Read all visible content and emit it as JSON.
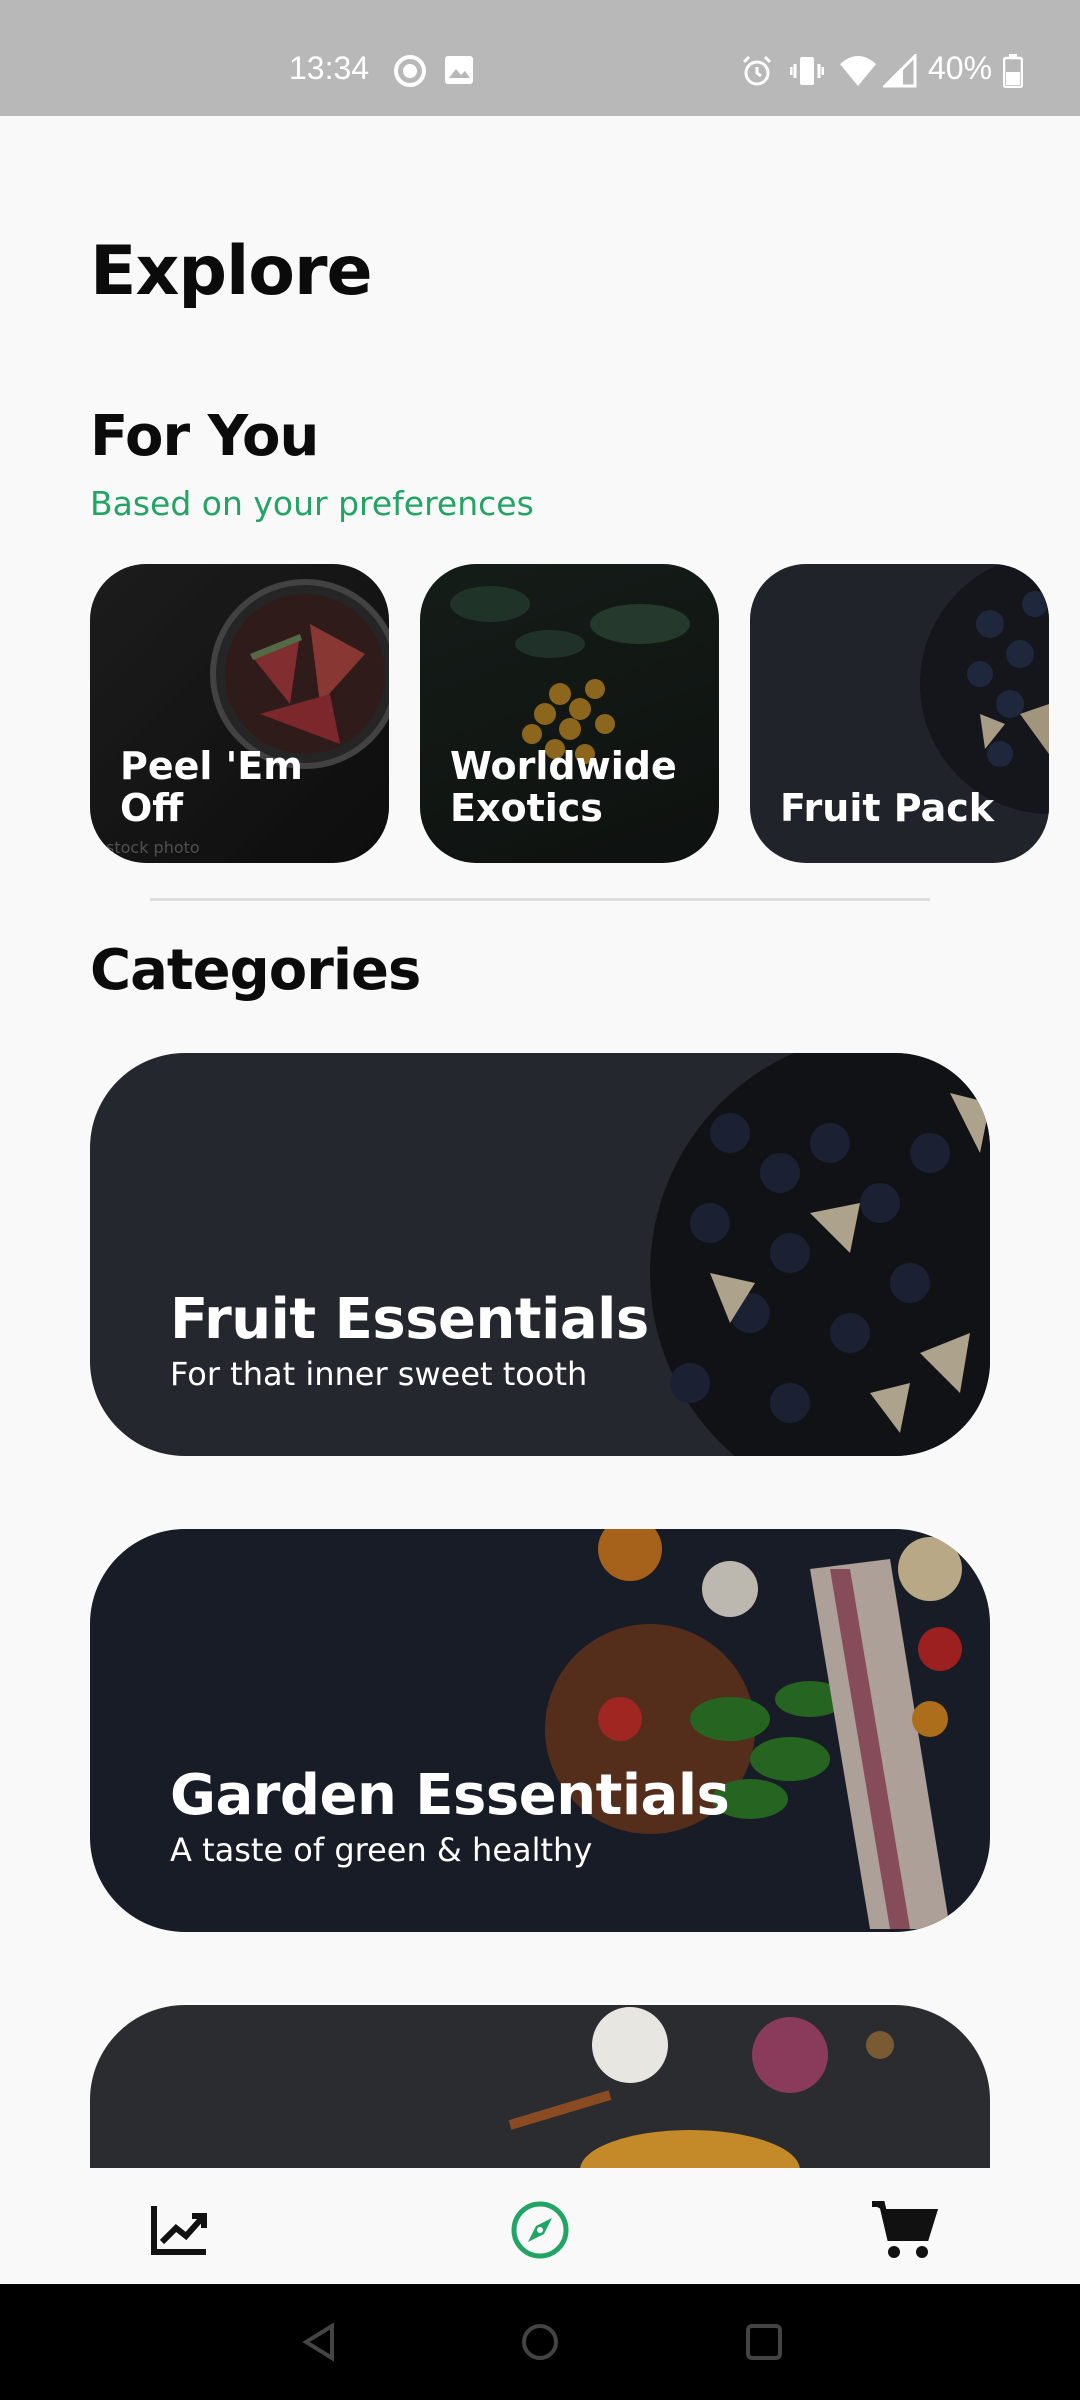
{
  "status_bar": {
    "time": "13:34",
    "battery": "40%",
    "icons": [
      "record-icon",
      "image-icon",
      "alarm-icon",
      "vibrate-icon",
      "wifi-icon",
      "signal-icon",
      "battery-icon"
    ]
  },
  "page": {
    "title": "Explore"
  },
  "for_you": {
    "title": "For You",
    "subtitle": "Based on your preferences",
    "cards": [
      {
        "label": "Peel 'Em Off",
        "watermark": "stock photo"
      },
      {
        "label": "Worldwide Exotics"
      },
      {
        "label": "Fruit Pack"
      }
    ]
  },
  "categories": {
    "title": "Categories",
    "items": [
      {
        "title": "Fruit Essentials",
        "subtitle": "For that inner sweet tooth"
      },
      {
        "title": "Garden Essentials",
        "subtitle": "A taste of green & healthy"
      },
      {
        "title": "",
        "subtitle": ""
      }
    ]
  },
  "bottom_nav": {
    "items": [
      {
        "icon": "trending-chart-icon",
        "active": false
      },
      {
        "icon": "compass-icon",
        "active": true
      },
      {
        "icon": "cart-icon",
        "active": false
      }
    ],
    "active_color": "#21a464"
  },
  "colors": {
    "accent": "#21a464",
    "text": "#0b0b0b",
    "background": "#f9f9f9"
  }
}
